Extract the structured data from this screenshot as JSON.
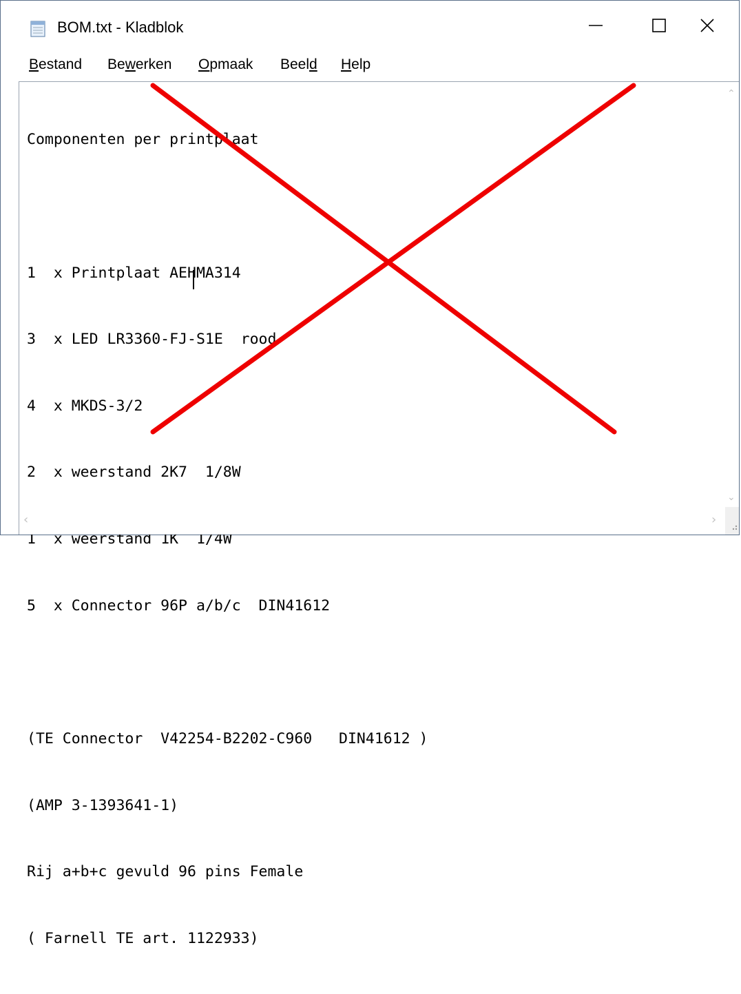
{
  "window": {
    "title": "BOM.txt - Kladblok",
    "icon": "notepad-icon"
  },
  "window_controls": {
    "minimize_icon": "minimize-icon",
    "maximize_icon": "maximize-icon",
    "close_icon": "close-icon"
  },
  "menu": {
    "items": [
      {
        "label_pre": "",
        "mnemonic": "B",
        "label_post": "estand"
      },
      {
        "label_pre": "Be",
        "mnemonic": "w",
        "label_post": "erken"
      },
      {
        "label_pre": "",
        "mnemonic": "O",
        "label_post": "pmaak"
      },
      {
        "label_pre": "Beel",
        "mnemonic": "d",
        "label_post": ""
      },
      {
        "label_pre": "",
        "mnemonic": "H",
        "label_post": "elp"
      }
    ]
  },
  "document": {
    "lines": [
      "Componenten per printplaat",
      "",
      "1  x Printplaat AEHMA314",
      "3  x LED LR3360-FJ-S1E  rood",
      "4  x MKDS-3/2",
      "2  x weerstand 2K7  1/8W",
      "1  x weerstand 1K  1/4W",
      "5  x Connector 96P a/b/c  DIN41612",
      "",
      "(TE Connector  V42254-B2202-C960   DIN41612 )",
      "(AMP 3-1393641-1)",
      "Rij a+b+c gevuld 96 pins Female",
      "( Farnell TE art. 1122933)"
    ]
  },
  "overlay": {
    "type": "cross-out",
    "color": "#ee0000"
  },
  "scrollbars": {
    "up_icon": "scroll-up-arrow-icon",
    "down_icon": "scroll-down-arrow-icon",
    "left_icon": "scroll-left-arrow-icon",
    "right_icon": "scroll-right-arrow-icon",
    "grip_icon": "resize-grip-icon"
  }
}
